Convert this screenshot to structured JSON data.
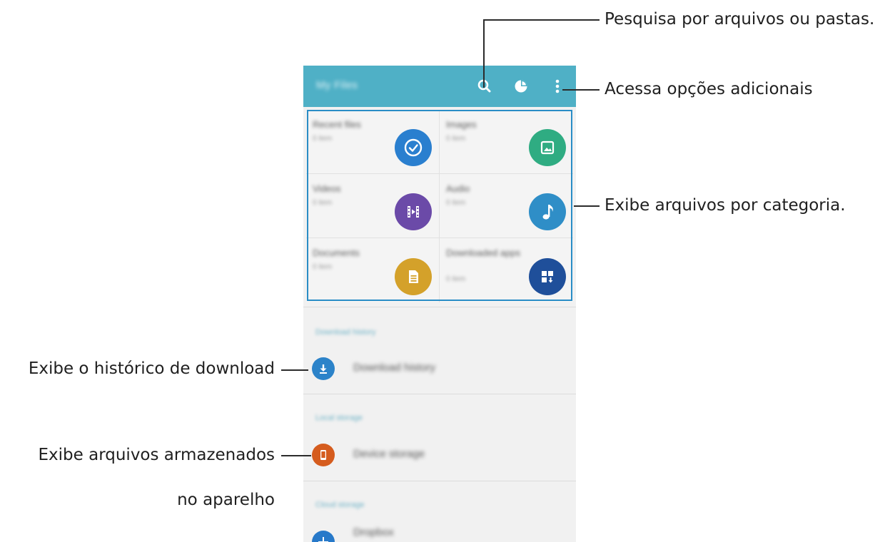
{
  "app": {
    "title": "My Files",
    "accent_color": "#4fb0c6",
    "icons": [
      "search-icon",
      "storage-usage-icon",
      "more-options-icon"
    ]
  },
  "categories": [
    {
      "name": "Recent files",
      "count": "0 item",
      "icon": "clock-icon",
      "color": "#2a7fcf"
    },
    {
      "name": "Images",
      "count": "0 item",
      "icon": "image-icon",
      "color": "#2fac82"
    },
    {
      "name": "Videos",
      "count": "0 item",
      "icon": "video-icon",
      "color": "#6b4aa8"
    },
    {
      "name": "Audio",
      "count": "0 item",
      "icon": "music-note-icon",
      "color": "#2f8ec7"
    },
    {
      "name": "Documents",
      "count": "0 item",
      "icon": "document-icon",
      "color": "#d4a12a"
    },
    {
      "name": "Downloaded apps",
      "count": "0 item",
      "icon": "download-apps-icon",
      "color": "#1f4f9a"
    }
  ],
  "sections": {
    "download_history": {
      "label": "Download history",
      "item": "Download history",
      "icon": "download-icon",
      "color": "#2c83c9"
    },
    "local_storage": {
      "label": "Local storage",
      "item": "Device storage",
      "icon": "phone-icon",
      "color": "#d55c1e"
    },
    "cloud_storage": {
      "label": "Cloud storage",
      "item": "Dropbox",
      "icon": "dropbox-icon",
      "color": "#2779c9"
    }
  },
  "callouts": {
    "search": "Pesquisa por arquivos ou pastas.",
    "more": "Acessa opções adicionais",
    "categories": "Exibe arquivos por categoria.",
    "download_history": "Exibe o histórico de download",
    "device_storage_line1": "Exibe arquivos armazenados",
    "device_storage_line2": "no aparelho"
  }
}
